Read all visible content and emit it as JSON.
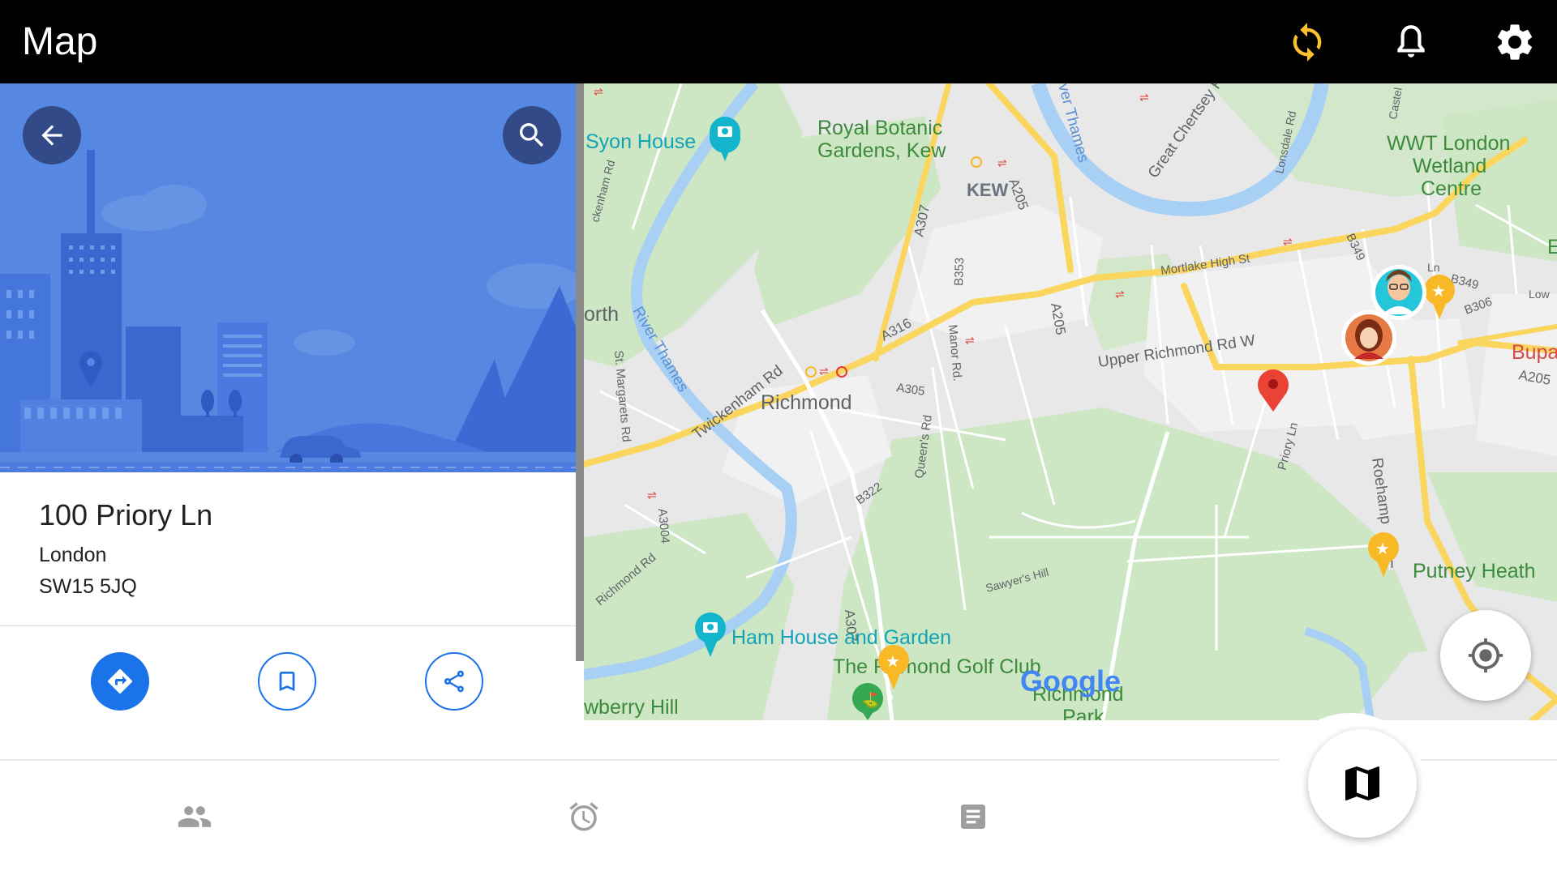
{
  "app_bar": {
    "title": "Map",
    "actions": [
      {
        "icon": "sync-icon",
        "color": "#fbc02d"
      },
      {
        "icon": "bell-icon",
        "color": "#ffffff"
      },
      {
        "icon": "gear-icon",
        "color": "#ffffff"
      }
    ]
  },
  "place": {
    "address_line1": "100 Priory Ln",
    "address_line2": "London",
    "address_line3": "SW15 5JQ",
    "hero_color": "#5687e1",
    "header_buttons": [
      "back-arrow-icon",
      "search-icon"
    ],
    "actions": [
      "directions-icon",
      "bookmark-icon",
      "share-icon"
    ],
    "accent": "#1a73e8"
  },
  "map": {
    "labels": {
      "syon_house": "Syon House",
      "royal_botanic_1": "Royal Botanic",
      "royal_botanic_2": "Gardens, Kew",
      "kew": "KEW",
      "wwt_1": "WWT London",
      "wwt_2": "Wetland",
      "wwt_3": "Centre",
      "richmond": "Richmond",
      "a316": "A316",
      "a307": "A307",
      "a307_south": "A307",
      "a205_north": "A205",
      "a205": "A205",
      "a205_east": "A205",
      "a305": "A305",
      "b353": "B353",
      "b322": "B322",
      "b349": "B349",
      "b349_east": "B349",
      "b306": "B306",
      "a3004": "A3004",
      "twickenham_rd": "Twickenham Rd",
      "upper_richmond_rd": "Upper Richmond Rd W",
      "mortlake_high_st": "Mortlake High St",
      "great_chertsey_rd": "Great Chertsey Rd",
      "lonsdale_rd": "Lonsdale Rd",
      "castelnau": "Castel",
      "manor_rd": "Manor Rd.",
      "queens_rd": "Queen's Rd",
      "st_margarets_rd": "St. Margarets Rd",
      "river_thames": "River Thames",
      "river_thames_north": "ver Thames",
      "richmond_rd": "Richmond Rd",
      "ckenham_rd": "ckenham Rd",
      "priory_ln": "Priory Ln",
      "roehampton": "Roehamp",
      "roehampton_2": "n",
      "sawyers_hill": "Sawyer's Hill",
      "putney_heath": "Putney Heath",
      "ham_house": "Ham House and Garden",
      "golf_club_1": "The R",
      "golf_club_2": "mond Golf Club",
      "richmond_park_1": "Richmond",
      "richmond_park_2": "Park",
      "petersham": "wberry Hill",
      "north_edge": "orth",
      "bupa": "Bupa",
      "low": "Low",
      "ln": "Ln",
      "edge_e": "E",
      "google": "Google"
    },
    "colors": {
      "land": "#e8e8e8",
      "park": "#cde6c3",
      "water": "#a8d0f5",
      "major_road": "#fbd65f",
      "minor_road": "#ffffff",
      "pin": "#ea4335",
      "poi_star": "#f9b826",
      "poi_camera": "#12b5cb"
    },
    "markers": [
      "red-pin-icon",
      "avatar-man",
      "avatar-woman",
      "star-poi-icon",
      "camera-poi-icon"
    ]
  },
  "bottom_nav": {
    "items": [
      "people-icon",
      "alarm-icon",
      "list-icon",
      "map-icon"
    ],
    "active": "map-icon"
  }
}
